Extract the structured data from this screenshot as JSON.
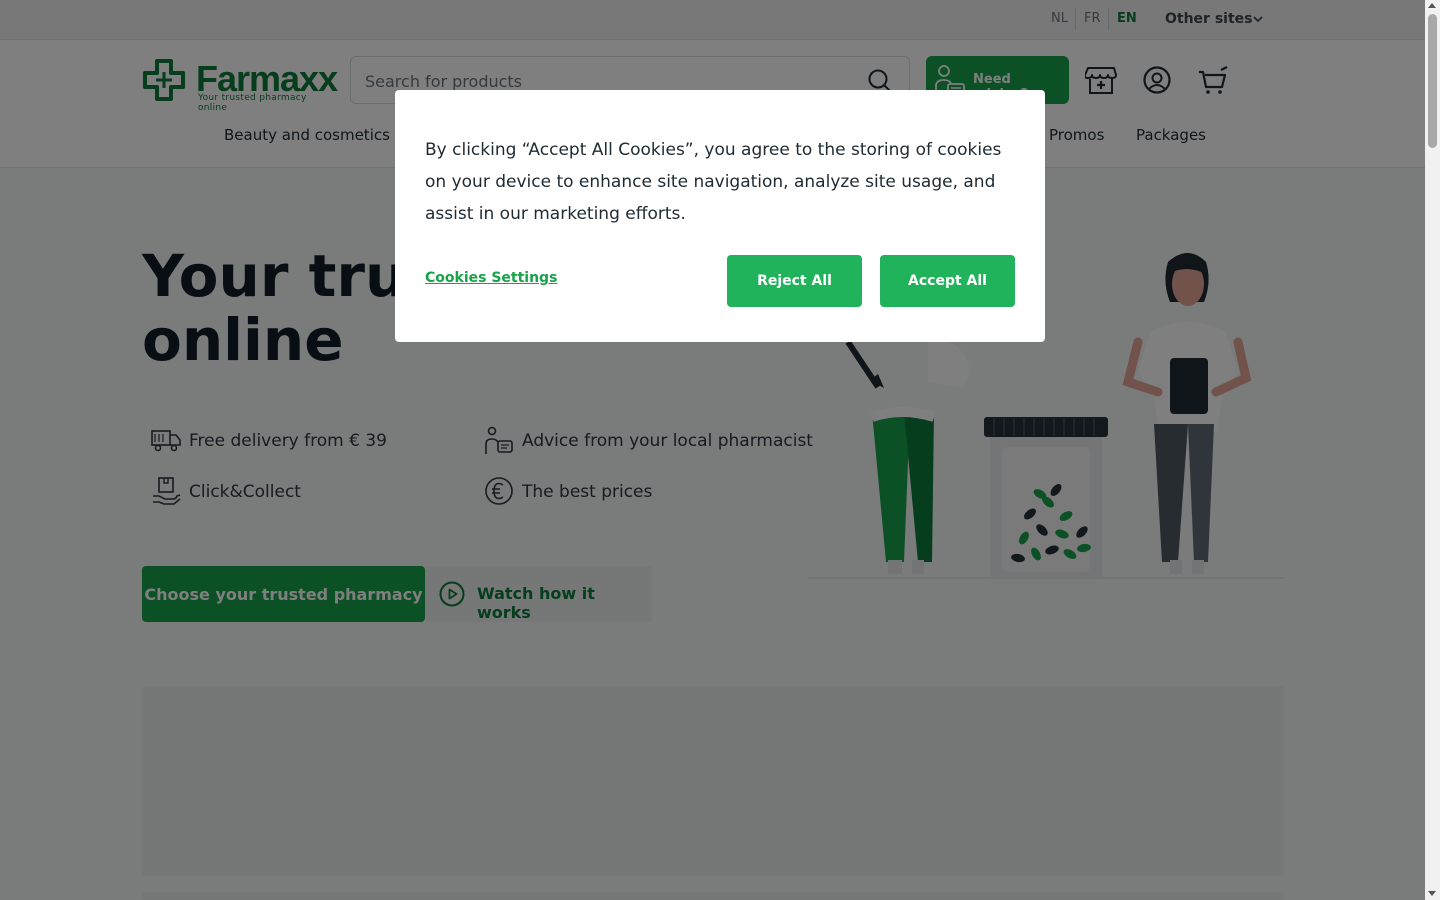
{
  "topbar": {
    "languages": [
      "NL",
      "FR",
      "EN"
    ],
    "active_language": "EN",
    "other_sites": "Other sites"
  },
  "header": {
    "logo_word": "Farmaxx",
    "logo_tagline": "Your trusted pharmacy online",
    "search_placeholder": "Search for products",
    "advice_label": "Need advice?",
    "icons": [
      "pharmacy-store-icon",
      "account-icon",
      "cart-icon"
    ]
  },
  "nav": {
    "items": [
      "Beauty and cosmetics",
      "Promos",
      "Packages"
    ]
  },
  "hero": {
    "title_line1": "Your trust",
    "title_line2": "online",
    "usps": [
      {
        "label": "Free delivery from € 39",
        "icon": "truck-icon"
      },
      {
        "label": "Advice from your local pharmacist",
        "icon": "pharmacist-icon"
      },
      {
        "label": "Click&Collect",
        "icon": "package-hand-icon"
      },
      {
        "label": "The best prices",
        "icon": "euro-icon"
      }
    ],
    "primary_button": "Choose your trusted pharmacy",
    "secondary_button": "Watch how it works"
  },
  "cookie_modal": {
    "text": "By clicking “Accept All Cookies”, you agree to the storing of cookies on your device to enhance site navigation, analyze site usage, and assist in our marketing efforts.",
    "settings_link": "Cookies Settings",
    "reject_label": "Reject All",
    "accept_label": "Accept All"
  },
  "colors": {
    "brand_green": "#0d7a3b",
    "button_green": "#16a34a",
    "overlay": "rgba(0,0,0,0.5)"
  }
}
